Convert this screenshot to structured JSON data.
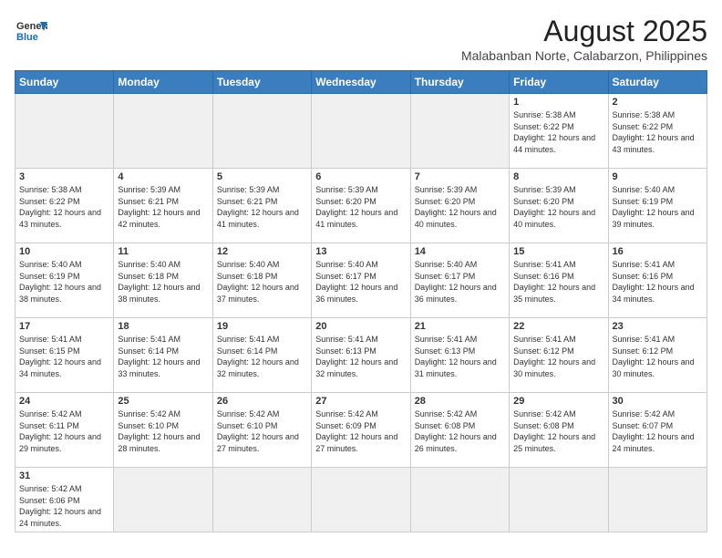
{
  "header": {
    "logo_line1": "General",
    "logo_line2": "Blue",
    "title": "August 2025",
    "subtitle": "Malabanban Norte, Calabarzon, Philippines"
  },
  "weekdays": [
    "Sunday",
    "Monday",
    "Tuesday",
    "Wednesday",
    "Thursday",
    "Friday",
    "Saturday"
  ],
  "weeks": [
    [
      {
        "day": "",
        "info": ""
      },
      {
        "day": "",
        "info": ""
      },
      {
        "day": "",
        "info": ""
      },
      {
        "day": "",
        "info": ""
      },
      {
        "day": "",
        "info": ""
      },
      {
        "day": "1",
        "info": "Sunrise: 5:38 AM\nSunset: 6:22 PM\nDaylight: 12 hours and 44 minutes."
      },
      {
        "day": "2",
        "info": "Sunrise: 5:38 AM\nSunset: 6:22 PM\nDaylight: 12 hours and 43 minutes."
      }
    ],
    [
      {
        "day": "3",
        "info": "Sunrise: 5:38 AM\nSunset: 6:22 PM\nDaylight: 12 hours and 43 minutes."
      },
      {
        "day": "4",
        "info": "Sunrise: 5:39 AM\nSunset: 6:21 PM\nDaylight: 12 hours and 42 minutes."
      },
      {
        "day": "5",
        "info": "Sunrise: 5:39 AM\nSunset: 6:21 PM\nDaylight: 12 hours and 41 minutes."
      },
      {
        "day": "6",
        "info": "Sunrise: 5:39 AM\nSunset: 6:20 PM\nDaylight: 12 hours and 41 minutes."
      },
      {
        "day": "7",
        "info": "Sunrise: 5:39 AM\nSunset: 6:20 PM\nDaylight: 12 hours and 40 minutes."
      },
      {
        "day": "8",
        "info": "Sunrise: 5:39 AM\nSunset: 6:20 PM\nDaylight: 12 hours and 40 minutes."
      },
      {
        "day": "9",
        "info": "Sunrise: 5:40 AM\nSunset: 6:19 PM\nDaylight: 12 hours and 39 minutes."
      }
    ],
    [
      {
        "day": "10",
        "info": "Sunrise: 5:40 AM\nSunset: 6:19 PM\nDaylight: 12 hours and 38 minutes."
      },
      {
        "day": "11",
        "info": "Sunrise: 5:40 AM\nSunset: 6:18 PM\nDaylight: 12 hours and 38 minutes."
      },
      {
        "day": "12",
        "info": "Sunrise: 5:40 AM\nSunset: 6:18 PM\nDaylight: 12 hours and 37 minutes."
      },
      {
        "day": "13",
        "info": "Sunrise: 5:40 AM\nSunset: 6:17 PM\nDaylight: 12 hours and 36 minutes."
      },
      {
        "day": "14",
        "info": "Sunrise: 5:40 AM\nSunset: 6:17 PM\nDaylight: 12 hours and 36 minutes."
      },
      {
        "day": "15",
        "info": "Sunrise: 5:41 AM\nSunset: 6:16 PM\nDaylight: 12 hours and 35 minutes."
      },
      {
        "day": "16",
        "info": "Sunrise: 5:41 AM\nSunset: 6:16 PM\nDaylight: 12 hours and 34 minutes."
      }
    ],
    [
      {
        "day": "17",
        "info": "Sunrise: 5:41 AM\nSunset: 6:15 PM\nDaylight: 12 hours and 34 minutes."
      },
      {
        "day": "18",
        "info": "Sunrise: 5:41 AM\nSunset: 6:14 PM\nDaylight: 12 hours and 33 minutes."
      },
      {
        "day": "19",
        "info": "Sunrise: 5:41 AM\nSunset: 6:14 PM\nDaylight: 12 hours and 32 minutes."
      },
      {
        "day": "20",
        "info": "Sunrise: 5:41 AM\nSunset: 6:13 PM\nDaylight: 12 hours and 32 minutes."
      },
      {
        "day": "21",
        "info": "Sunrise: 5:41 AM\nSunset: 6:13 PM\nDaylight: 12 hours and 31 minutes."
      },
      {
        "day": "22",
        "info": "Sunrise: 5:41 AM\nSunset: 6:12 PM\nDaylight: 12 hours and 30 minutes."
      },
      {
        "day": "23",
        "info": "Sunrise: 5:41 AM\nSunset: 6:12 PM\nDaylight: 12 hours and 30 minutes."
      }
    ],
    [
      {
        "day": "24",
        "info": "Sunrise: 5:42 AM\nSunset: 6:11 PM\nDaylight: 12 hours and 29 minutes."
      },
      {
        "day": "25",
        "info": "Sunrise: 5:42 AM\nSunset: 6:10 PM\nDaylight: 12 hours and 28 minutes."
      },
      {
        "day": "26",
        "info": "Sunrise: 5:42 AM\nSunset: 6:10 PM\nDaylight: 12 hours and 27 minutes."
      },
      {
        "day": "27",
        "info": "Sunrise: 5:42 AM\nSunset: 6:09 PM\nDaylight: 12 hours and 27 minutes."
      },
      {
        "day": "28",
        "info": "Sunrise: 5:42 AM\nSunset: 6:08 PM\nDaylight: 12 hours and 26 minutes."
      },
      {
        "day": "29",
        "info": "Sunrise: 5:42 AM\nSunset: 6:08 PM\nDaylight: 12 hours and 25 minutes."
      },
      {
        "day": "30",
        "info": "Sunrise: 5:42 AM\nSunset: 6:07 PM\nDaylight: 12 hours and 24 minutes."
      }
    ],
    [
      {
        "day": "31",
        "info": "Sunrise: 5:42 AM\nSunset: 6:06 PM\nDaylight: 12 hours and 24 minutes."
      },
      {
        "day": "",
        "info": ""
      },
      {
        "day": "",
        "info": ""
      },
      {
        "day": "",
        "info": ""
      },
      {
        "day": "",
        "info": ""
      },
      {
        "day": "",
        "info": ""
      },
      {
        "day": "",
        "info": ""
      }
    ]
  ]
}
